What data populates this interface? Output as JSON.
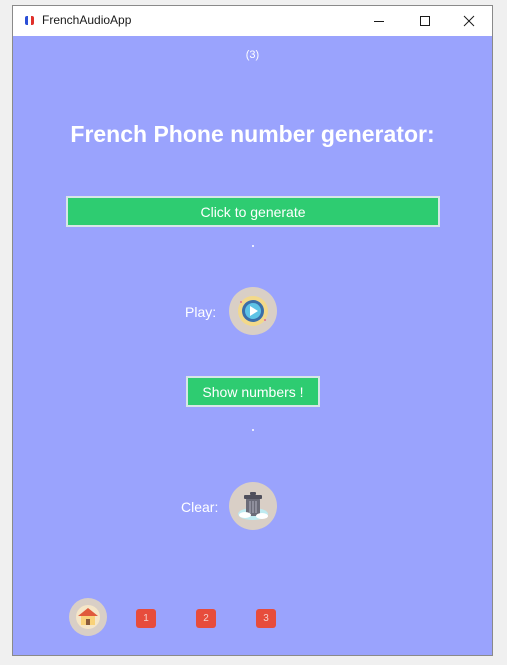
{
  "window": {
    "title": "FrenchAudioApp",
    "icon": "flag-icon",
    "controls": [
      "minimize-icon",
      "maximize-icon",
      "close-icon"
    ]
  },
  "main": {
    "counter": "(3)",
    "heading": "French Phone number generator:",
    "generate_label": "Click to generate",
    "play_label": "Play:",
    "play_icon": "play-icon",
    "show_numbers_label": "Show numbers !",
    "clear_label": "Clear:",
    "clear_icon": "trash-icon"
  },
  "footer": {
    "home_icon": "home-icon",
    "pages": [
      "1",
      "2",
      "3"
    ]
  },
  "colors": {
    "background": "#9aa3fd",
    "button_green": "#2ecc71",
    "page_red": "#e74c3c"
  }
}
